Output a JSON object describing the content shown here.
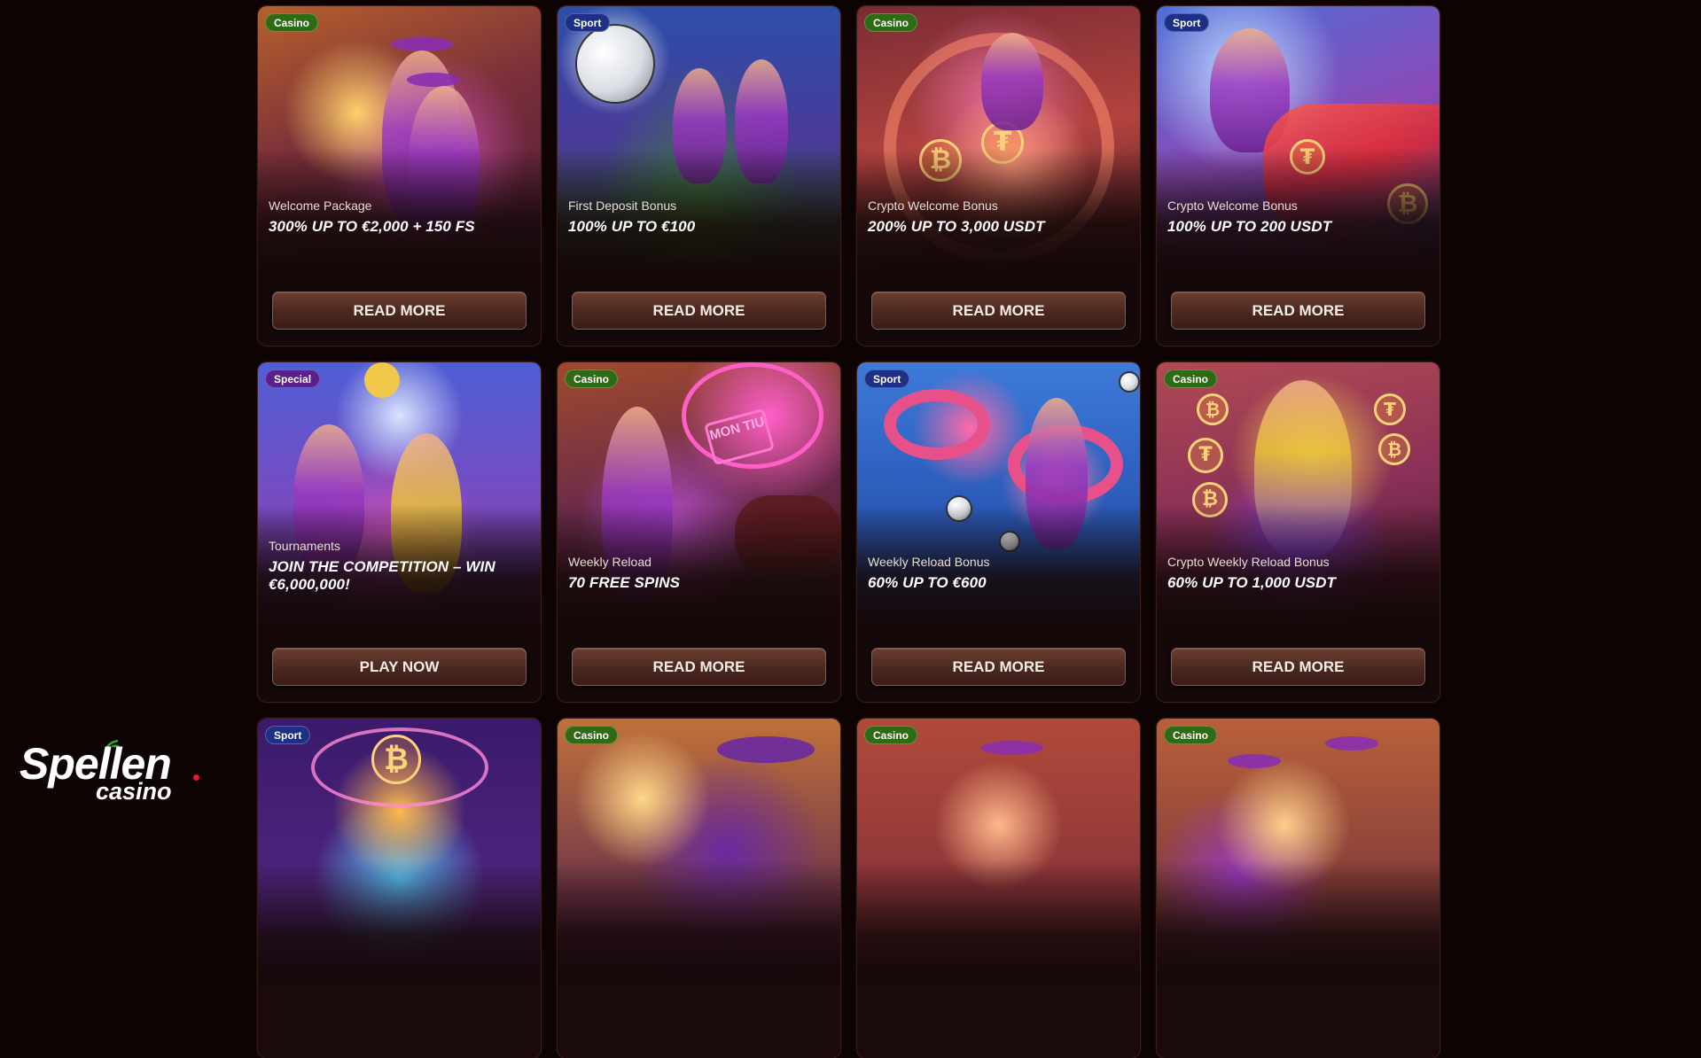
{
  "cards": [
    {
      "badge": "Casino",
      "badge_type": "casino",
      "subtitle": "Welcome Package",
      "title": "300% UP TO €2,000 + 150 FS",
      "cta": "READ MORE"
    },
    {
      "badge": "Sport",
      "badge_type": "sport",
      "subtitle": "First Deposit Bonus",
      "title": "100% UP TO €100",
      "cta": "READ MORE"
    },
    {
      "badge": "Casino",
      "badge_type": "casino",
      "subtitle": "Crypto Welcome Bonus",
      "title": "200% UP TO 3,000 USDT",
      "cta": "READ MORE"
    },
    {
      "badge": "Sport",
      "badge_type": "sport",
      "subtitle": "Crypto Welcome Bonus",
      "title": "100% UP TO 200 USDT",
      "cta": "READ MORE"
    },
    {
      "badge": "Special",
      "badge_type": "special",
      "subtitle": "Tournaments",
      "title": "JOIN THE COMPETITION – WIN €6,000,000!",
      "cta": "PLAY NOW"
    },
    {
      "badge": "Casino",
      "badge_type": "casino",
      "subtitle": "Weekly Reload",
      "title": "70 FREE SPINS",
      "cta": "READ MORE"
    },
    {
      "badge": "Sport",
      "badge_type": "sport",
      "subtitle": "Weekly Reload Bonus",
      "title": "60% UP TO €600",
      "cta": "READ MORE"
    },
    {
      "badge": "Casino",
      "badge_type": "casino",
      "subtitle": "Crypto Weekly Reload Bonus",
      "title": "60% UP TO 1,000 USDT",
      "cta": "READ MORE"
    },
    {
      "badge": "Sport",
      "badge_type": "sport"
    },
    {
      "badge": "Casino",
      "badge_type": "casino"
    },
    {
      "badge": "Casino",
      "badge_type": "casino"
    },
    {
      "badge": "Casino",
      "badge_type": "casino"
    }
  ],
  "logo": {
    "main": "Spellen",
    "sub": "casino"
  },
  "art": {
    "neon_sign": "MON TIU",
    "coin_btc": "₿",
    "coin_tether": "₮"
  },
  "colors": {
    "background": "#0d0303",
    "badge_casino": "#2f6a15",
    "badge_sport": "#1d2f86",
    "badge_special": "#5a1f8a",
    "button": "#4a271f",
    "logo_accent": "#e21c2a"
  }
}
